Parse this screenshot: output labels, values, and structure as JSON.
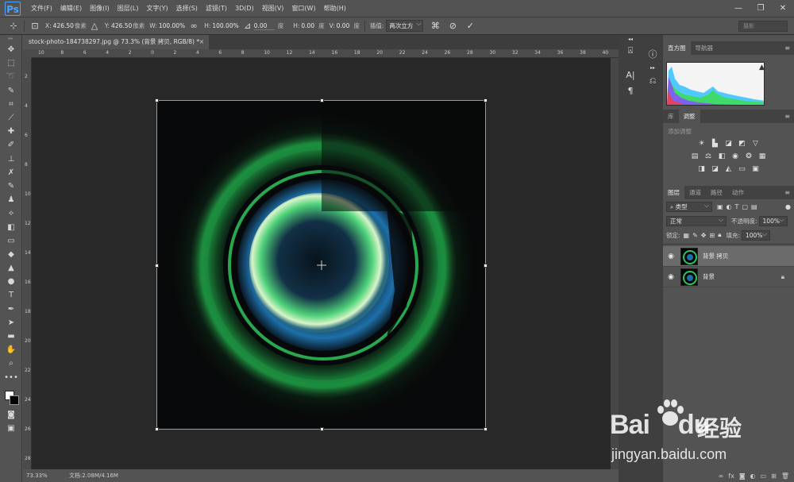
{
  "app": {
    "logo": "Ps",
    "menu": [
      "文件(F)",
      "编辑(E)",
      "图像(I)",
      "图层(L)",
      "文字(Y)",
      "选择(S)",
      "滤镜(T)",
      "3D(D)",
      "视图(V)",
      "窗口(W)",
      "帮助(H)"
    ],
    "window_controls": [
      "—",
      "❐",
      "✕"
    ]
  },
  "options": {
    "x_label": "X:",
    "x_value": "426.50",
    "x_unit": "像素",
    "y_label": "Y:",
    "y_value": "426.50",
    "y_unit": "像素",
    "w_label": "W:",
    "w_value": "100.00%",
    "h_label": "H:",
    "h_value": "100.00%",
    "angle_value": "0.00",
    "angle_unit": "度",
    "hskew_label": "H:",
    "hskew_value": "0.00",
    "hskew_unit": "度",
    "vskew_label": "V:",
    "vskew_value": "0.00",
    "vskew_unit": "度",
    "interp_label": "插值:",
    "interp_value": "两次立方",
    "workspace": "摄影"
  },
  "document": {
    "tab_title": "stock-photo-184738297.jpg @ 73.3% (背景 拷贝, RGB/8) *",
    "close": "×"
  },
  "rulers": {
    "h_labels": [
      "10",
      "8",
      "6",
      "4",
      "2",
      "0",
      "2",
      "4",
      "6",
      "8",
      "10",
      "12",
      "14",
      "16",
      "18",
      "20",
      "22",
      "24",
      "26",
      "28",
      "30",
      "32",
      "34",
      "36",
      "38",
      "40"
    ],
    "v_labels": [
      "2",
      "4",
      "6",
      "8",
      "10",
      "12",
      "14",
      "16",
      "18",
      "20",
      "22",
      "24",
      "26",
      "28"
    ]
  },
  "status": {
    "zoom": "73.33%",
    "doc": "文档:2.08M/4.16M"
  },
  "panels": {
    "histogram": {
      "tabs": [
        "直方图",
        "导航器"
      ],
      "warning": "▲"
    },
    "adjustments": {
      "tabs": [
        "库",
        "调整"
      ],
      "title": "添加调整"
    },
    "layers": {
      "tabs": [
        "图层",
        "通道",
        "路径",
        "动作"
      ],
      "kind_filter": "类型",
      "blend_mode": "正常",
      "opacity_label": "不透明度:",
      "opacity_value": "100%",
      "lock_label": "锁定:",
      "fill_label": "填充:",
      "fill_value": "100%",
      "items": [
        {
          "name": "背景 拷贝",
          "selected": true
        },
        {
          "name": "背景",
          "selected": false,
          "locked": true
        }
      ]
    }
  },
  "watermark": {
    "brand": "Bai",
    "brand2": "du",
    "cn": "经验",
    "url": "jingyan.baidu.com"
  },
  "colors": {
    "aurora_green": "#3ddc5a",
    "sky_blue": "#1e6fa8"
  }
}
